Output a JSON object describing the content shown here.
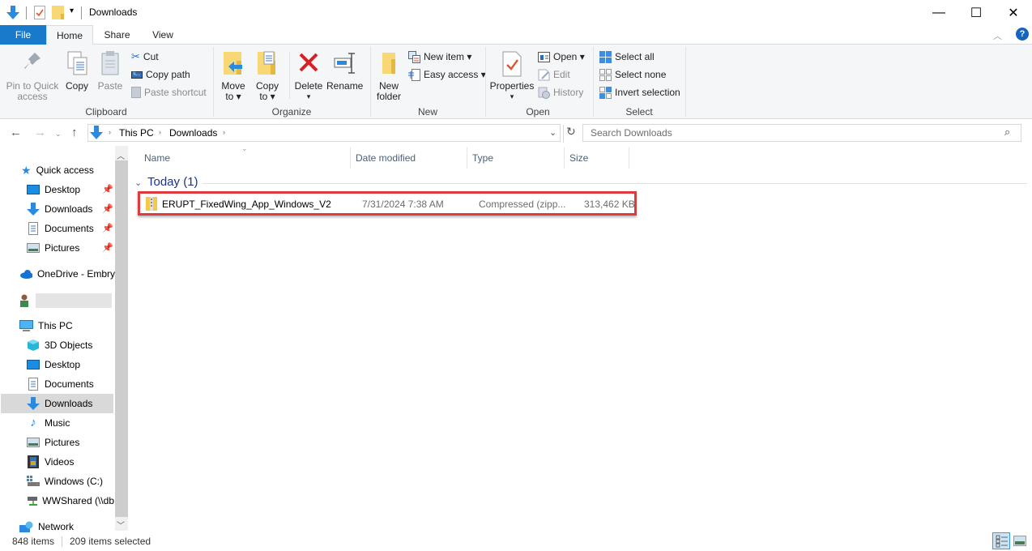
{
  "window": {
    "title": "Downloads",
    "controls": {
      "minimize": "—",
      "maximize": "☐",
      "close": "✕"
    }
  },
  "quick_access_toolbar": {
    "icons": [
      "downloads-arrow-icon",
      "properties-icon",
      "new-folder-icon",
      "customize-dropdown-icon"
    ]
  },
  "tabs": [
    {
      "label": "File",
      "active": false
    },
    {
      "label": "Home",
      "active": true
    },
    {
      "label": "Share",
      "active": false
    },
    {
      "label": "View",
      "active": false
    }
  ],
  "ribbon": {
    "clipboard": {
      "label": "Clipboard",
      "pin_line1": "Pin to Quick",
      "pin_line2": "access",
      "copy": "Copy",
      "paste": "Paste",
      "cut": "Cut",
      "copy_path": "Copy path",
      "paste_shortcut": "Paste shortcut"
    },
    "organize": {
      "label": "Organize",
      "move_line1": "Move",
      "move_line2": "to ▾",
      "copy_line1": "Copy",
      "copy_line2": "to ▾",
      "delete": "Delete",
      "delete_arrow": "▾",
      "rename": "Rename"
    },
    "new": {
      "label": "New",
      "new_folder_line1": "New",
      "new_folder_line2": "folder",
      "new_item": "New item ▾",
      "easy_access": "Easy access ▾"
    },
    "open": {
      "label": "Open",
      "properties": "Properties",
      "properties_arrow": "▾",
      "open": "Open ▾",
      "edit": "Edit",
      "history": "History"
    },
    "select": {
      "label": "Select",
      "select_all": "Select all",
      "select_none": "Select none",
      "invert_selection": "Invert selection"
    }
  },
  "address": {
    "breadcrumb": [
      "This PC",
      "Downloads"
    ],
    "search_placeholder": "Search Downloads"
  },
  "nav_pane": {
    "quick_access": "Quick access",
    "quick_items": [
      {
        "label": "Desktop",
        "pinned": true
      },
      {
        "label": "Downloads",
        "pinned": true
      },
      {
        "label": "Documents",
        "pinned": true
      },
      {
        "label": "Pictures",
        "pinned": true
      }
    ],
    "onedrive": "OneDrive - Embry",
    "user": "",
    "this_pc": "This PC",
    "pc_items": [
      {
        "label": "3D Objects"
      },
      {
        "label": "Desktop"
      },
      {
        "label": "Documents"
      },
      {
        "label": "Downloads",
        "selected": true
      },
      {
        "label": "Music"
      },
      {
        "label": "Pictures"
      },
      {
        "label": "Videos"
      },
      {
        "label": "Windows (C:)"
      },
      {
        "label": "WWShared (\\\\db"
      }
    ],
    "network": "Network"
  },
  "file_list": {
    "columns": [
      "Name",
      "Date modified",
      "Type",
      "Size"
    ],
    "group": "Today (1)",
    "rows": [
      {
        "name": "ERUPT_FixedWing_App_Windows_V2",
        "date": "7/31/2024 7:38 AM",
        "type": "Compressed (zipp...",
        "size": "313,462 KB"
      }
    ]
  },
  "status_bar": {
    "items": "848 items",
    "selected": "209 items selected"
  },
  "colors": {
    "accent": "#1979ca",
    "highlight_box": "#e0393e",
    "group_header": "#1e3287"
  }
}
